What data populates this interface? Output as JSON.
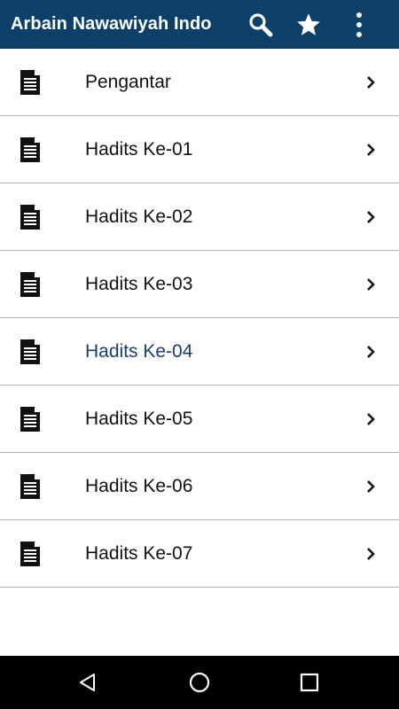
{
  "appbar": {
    "title": "Arbain Nawawiyah Indo",
    "background": "#0d4068",
    "actions": [
      {
        "name": "search",
        "icon": "search-icon"
      },
      {
        "name": "favorites",
        "icon": "star-icon"
      },
      {
        "name": "overflow-menu",
        "icon": "more-vert-icon"
      }
    ]
  },
  "list": {
    "items": [
      {
        "label": "Pengantar",
        "icon": "document-icon"
      },
      {
        "label": "Hadits Ke-01",
        "icon": "document-icon"
      },
      {
        "label": "Hadits Ke-02",
        "icon": "document-icon"
      },
      {
        "label": "Hadits Ke-03",
        "icon": "document-icon"
      },
      {
        "label": "Hadits Ke-04",
        "icon": "document-icon",
        "highlighted": true
      },
      {
        "label": "Hadits Ke-05",
        "icon": "document-icon"
      },
      {
        "label": "Hadits Ke-06",
        "icon": "document-icon"
      },
      {
        "label": "Hadits Ke-07",
        "icon": "document-icon"
      }
    ],
    "highlight_color": "#17406b"
  },
  "navbar": {
    "buttons": [
      "back-icon",
      "home-icon",
      "recent-apps-icon"
    ]
  }
}
